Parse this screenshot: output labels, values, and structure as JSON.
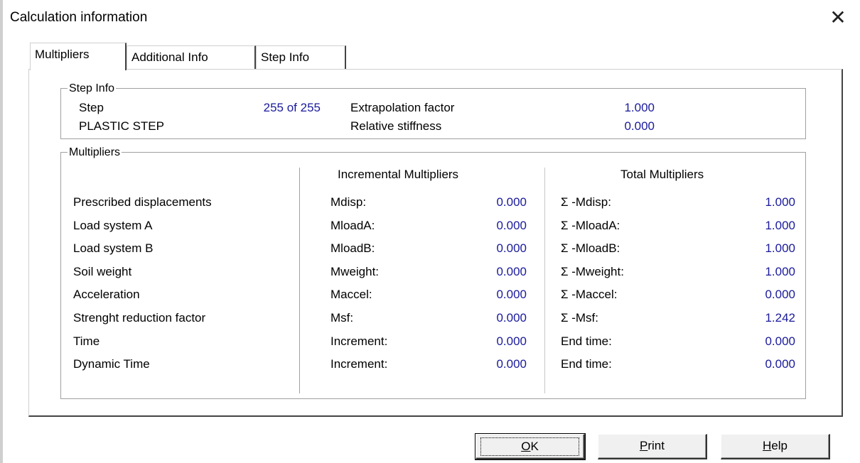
{
  "window": {
    "title": "Calculation information",
    "close_glyph": "✕"
  },
  "tabs": [
    {
      "label": "Multipliers",
      "active": true
    },
    {
      "label": "Additional Info",
      "active": false
    },
    {
      "label": "Step Info",
      "active": false
    }
  ],
  "step_info": {
    "group_label": "Step Info",
    "step_label": "Step",
    "step_value": "255 of 255",
    "step_type": "PLASTIC STEP",
    "extrapolation_label": "Extrapolation factor",
    "extrapolation_value": "1.000",
    "stiffness_label": "Relative stiffness",
    "stiffness_value": "0.000"
  },
  "multipliers": {
    "group_label": "Multipliers",
    "incremental_header": "Incremental Multipliers",
    "total_header": "Total Multipliers",
    "rows": [
      {
        "label": "Prescribed displacements",
        "inc_name": "Mdisp:",
        "inc_value": "0.000",
        "tot_name": "Σ -Mdisp:",
        "tot_value": "1.000"
      },
      {
        "label": "Load system A",
        "inc_name": "MloadA:",
        "inc_value": "0.000",
        "tot_name": "Σ -MloadA:",
        "tot_value": "1.000"
      },
      {
        "label": "Load system B",
        "inc_name": "MloadB:",
        "inc_value": "0.000",
        "tot_name": "Σ -MloadB:",
        "tot_value": "1.000"
      },
      {
        "label": "Soil weight",
        "inc_name": "Mweight:",
        "inc_value": "0.000",
        "tot_name": "Σ -Mweight:",
        "tot_value": "1.000"
      },
      {
        "label": "Acceleration",
        "inc_name": "Maccel:",
        "inc_value": "0.000",
        "tot_name": "Σ -Maccel:",
        "tot_value": "0.000"
      },
      {
        "label": "Strenght reduction factor",
        "inc_name": "Msf:",
        "inc_value": "0.000",
        "tot_name": "Σ -Msf:",
        "tot_value": "1.242"
      },
      {
        "label": "Time",
        "inc_name": "Increment:",
        "inc_value": "0.000",
        "tot_name": "End time:",
        "tot_value": "0.000"
      },
      {
        "label": "Dynamic Time",
        "inc_name": "Increment:",
        "inc_value": "0.000",
        "tot_name": "End time:",
        "tot_value": "0.000"
      }
    ]
  },
  "buttons": {
    "ok": {
      "mnemonic": "O",
      "rest": "K"
    },
    "print": {
      "mnemonic": "P",
      "rest": "rint"
    },
    "help": {
      "mnemonic": "H",
      "rest": "elp"
    }
  },
  "colors": {
    "value_text": "#1a1a9c"
  }
}
